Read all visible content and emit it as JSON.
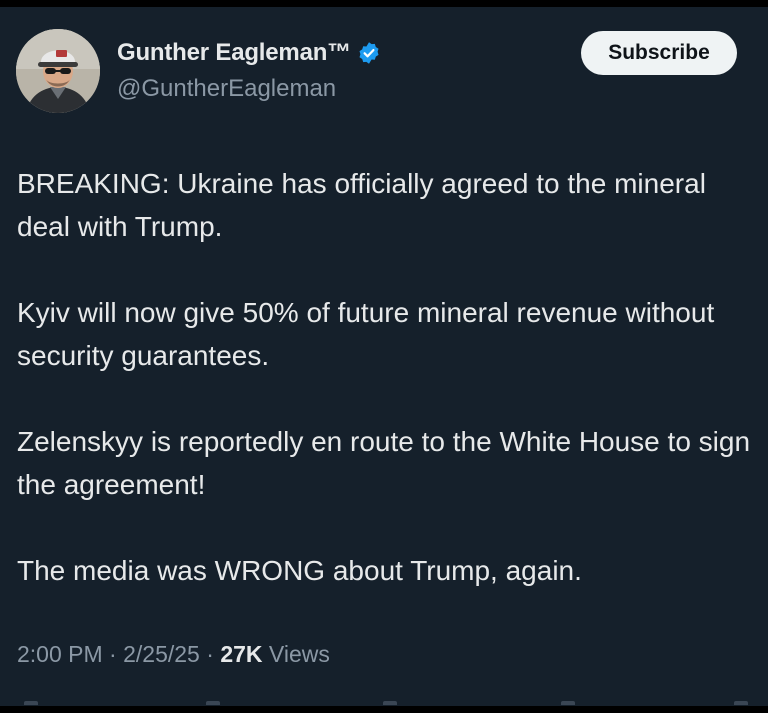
{
  "author": {
    "display_name": "Gunther Eagleman™",
    "handle": "@GuntherEagleman",
    "avatar_icon": "profile-photo",
    "verified_icon": "verified-badge-icon",
    "verified_color": "#1d9bf0"
  },
  "actions": {
    "subscribe_label": "Subscribe"
  },
  "tweet": {
    "paragraphs": [
      "BREAKING: Ukraine has officially agreed to the mineral deal with Trump.",
      "Kyiv will now give 50% of future mineral revenue without security guarantees.",
      "Zelenskyy is reportedly en route to the White House to sign the agreement!",
      "The media was WRONG about Trump, again."
    ]
  },
  "meta": {
    "time": "2:00 PM",
    "separator": " · ",
    "date": "2/25/25",
    "views_count": "27K",
    "views_label": " Views"
  },
  "colors": {
    "background": "#15202b",
    "text": "#e7e9ea",
    "secondary_text": "#8b98a5",
    "button_bg": "#eff3f4"
  }
}
